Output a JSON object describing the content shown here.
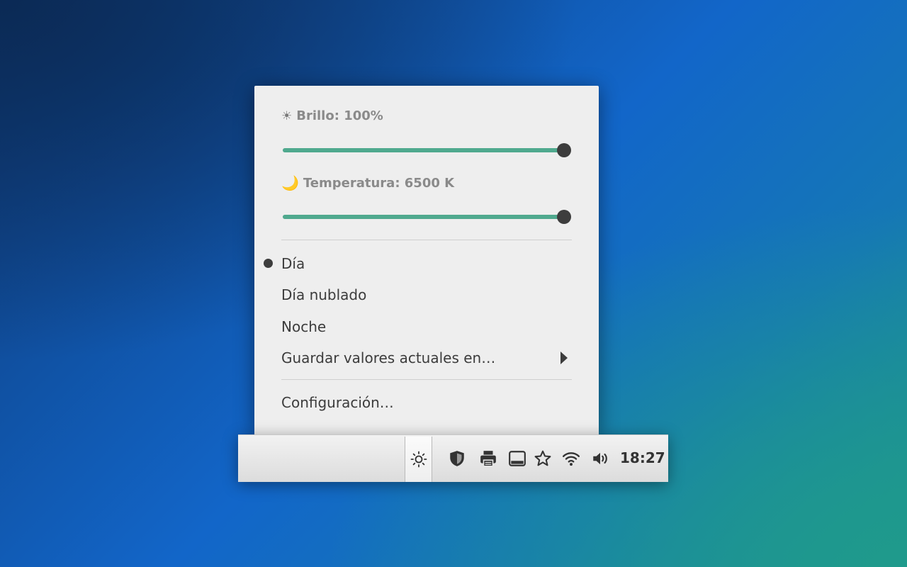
{
  "popup": {
    "brightness": {
      "icon": "sun-icon",
      "label": "Brillo: 100%",
      "value_percent": 100
    },
    "temperature": {
      "icon": "moon-icon",
      "label": "Temperatura: 6500 K",
      "value_percent": 100
    },
    "presets": [
      {
        "label": "Día",
        "selected": true
      },
      {
        "label": "Día nublado",
        "selected": false
      },
      {
        "label": "Noche",
        "selected": false
      }
    ],
    "save_submenu_label": "Guardar valores actuales en…",
    "settings_label": "Configuración…"
  },
  "panel": {
    "tray_icons": [
      "brightness-applet-icon",
      "shield-icon",
      "printer-icon",
      "display-icon",
      "star-icon",
      "wifi-icon",
      "volume-icon"
    ],
    "clock": "18:27"
  },
  "colors": {
    "slider_fill": "#4fa98e",
    "knob": "#3d3d3d",
    "menu_bg": "#eeeeee"
  }
}
